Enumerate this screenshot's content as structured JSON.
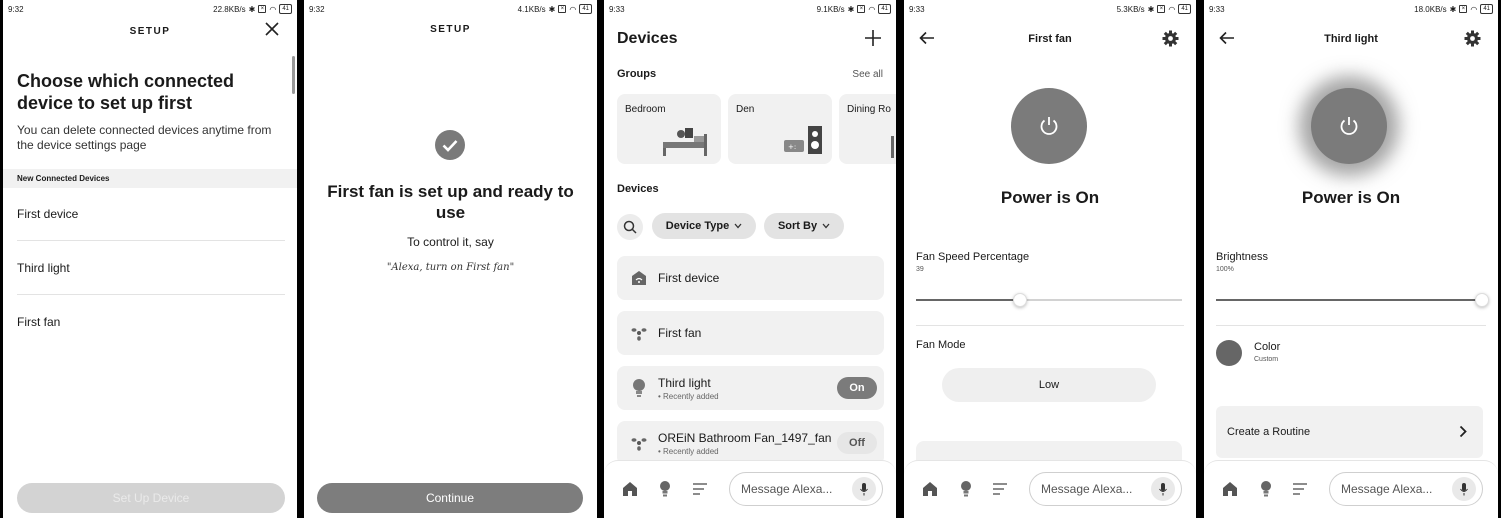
{
  "colors": {
    "power": "#7b7b7b",
    "button_disabled": "#d3d3d3",
    "button_enabled": "#7d7d7d",
    "card": "#f1f1f1"
  },
  "screen1": {
    "status": {
      "time": "9:32",
      "speed": "22.8KB/s",
      "battery": "41"
    },
    "header": "SETUP",
    "title": "Choose which connected device to set up first",
    "subtitle": "You can delete connected devices anytime from the device settings page",
    "section_label": "New Connected Devices",
    "devices": [
      "First device",
      "Third light",
      "First fan"
    ],
    "button": "Set Up Device"
  },
  "screen2": {
    "status": {
      "time": "9:32",
      "speed": "4.1KB/s",
      "battery": "41"
    },
    "header": "SETUP",
    "title": "First fan is set up and ready to use",
    "line1": "To control it, say",
    "quote": "\"Alexa, turn on First fan\"",
    "button": "Continue"
  },
  "screen3": {
    "status": {
      "time": "9:33",
      "speed": "9.1KB/s",
      "battery": "41"
    },
    "title": "Devices",
    "groups_label": "Groups",
    "see_all": "See all",
    "groups": [
      "Bedroom",
      "Den",
      "Dining Ro"
    ],
    "devices_label": "Devices",
    "filter_device_type": "Device Type",
    "filter_sort_by": "Sort By",
    "devices": [
      {
        "name": "First device",
        "sub": "",
        "toggle": ""
      },
      {
        "name": "First fan",
        "sub": "",
        "toggle": ""
      },
      {
        "name": "Third light",
        "sub": "• Recently added",
        "toggle": "On"
      },
      {
        "name": "OREiN Bathroom Fan_1497_fan",
        "sub": "• Recently added",
        "toggle": "Off"
      }
    ],
    "message_placeholder": "Message Alexa..."
  },
  "screen4": {
    "status": {
      "time": "9:33",
      "speed": "5.3KB/s",
      "battery": "41"
    },
    "title": "First fan",
    "power_text": "Power is On",
    "speed_label": "Fan Speed Percentage",
    "speed_value": "39",
    "speed_fraction": 0.39,
    "mode_label": "Fan Mode",
    "mode_value": "Low",
    "message_placeholder": "Message Alexa..."
  },
  "screen5": {
    "status": {
      "time": "9:33",
      "speed": "18.0KB/s",
      "battery": "41"
    },
    "title": "Third light",
    "power_text": "Power is On",
    "brightness_label": "Brightness",
    "brightness_value": "100%",
    "brightness_fraction": 1.0,
    "color_label": "Color",
    "color_value": "Custom",
    "routine_label": "Create a Routine",
    "message_placeholder": "Message Alexa..."
  }
}
